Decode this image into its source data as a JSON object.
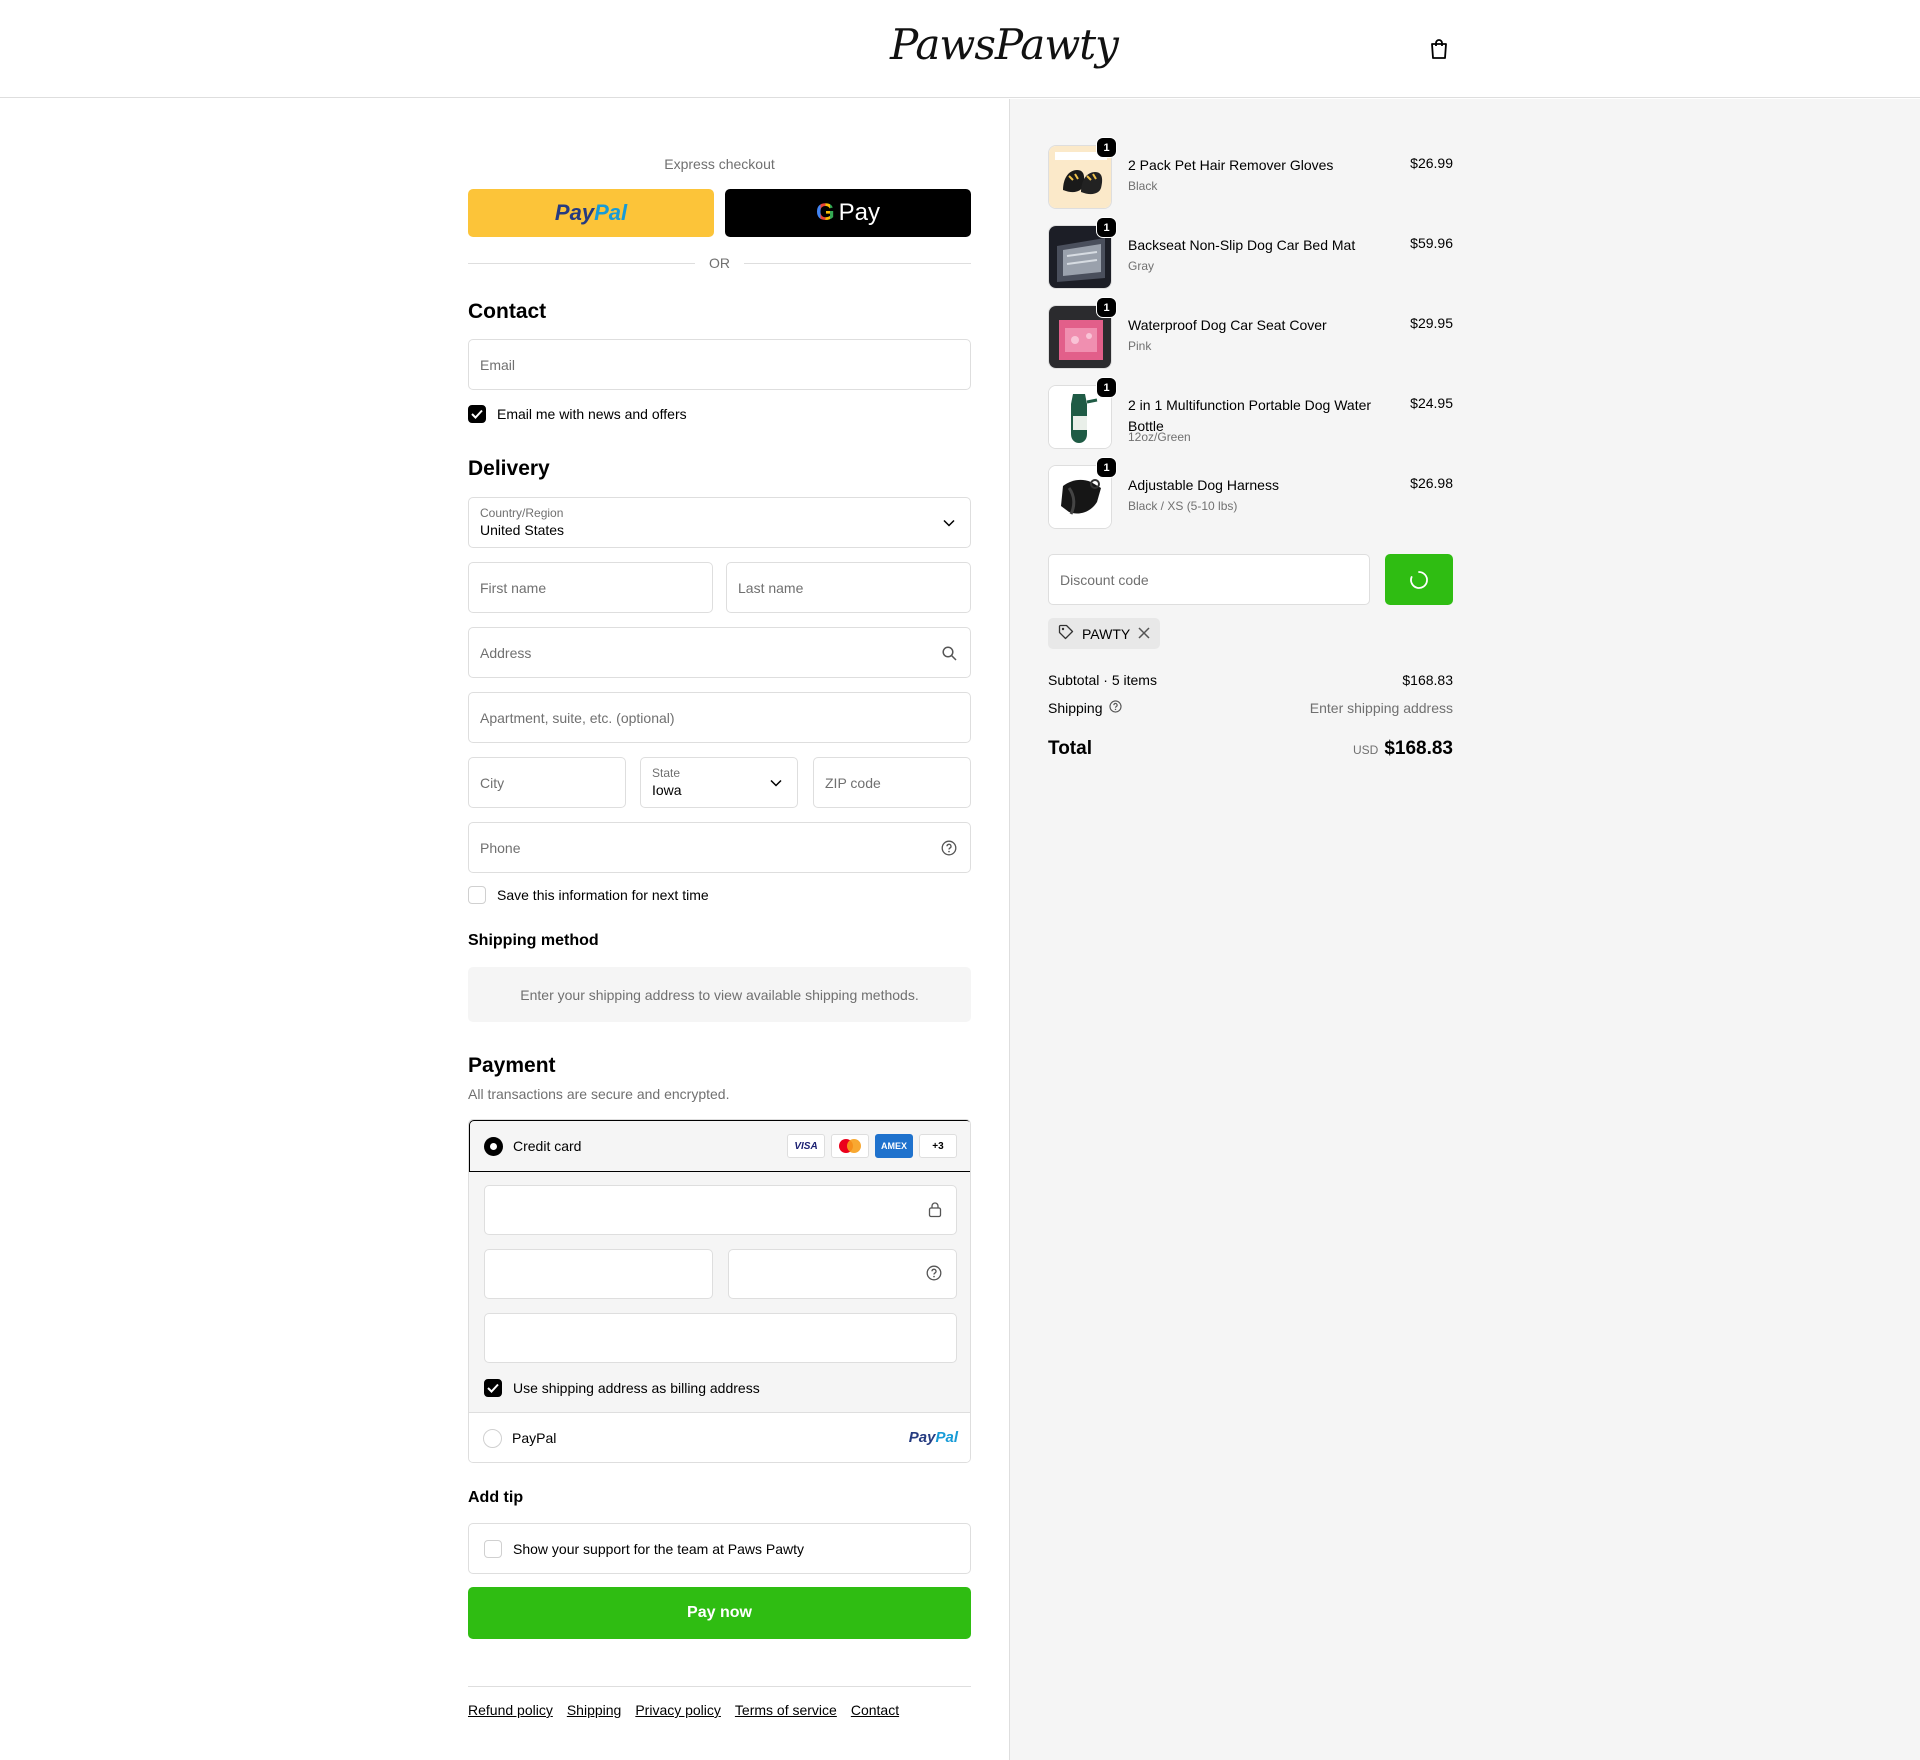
{
  "header": {
    "brand": "PawsPawty",
    "cart_icon": "shopping-bag-icon"
  },
  "express": {
    "title": "Express checkout",
    "paypal_a": "Pay",
    "paypal_b": "Pal",
    "gpay_g": "G",
    "gpay_label": "Pay",
    "or": "OR"
  },
  "contact": {
    "title": "Contact",
    "email_placeholder": "Email",
    "news_label": "Email me with news and offers",
    "news_checked": true
  },
  "delivery": {
    "title": "Delivery",
    "country_label": "Country/Region",
    "country_value": "United States",
    "first_name": "First name",
    "last_name": "Last name",
    "address": "Address",
    "apartment": "Apartment, suite, etc. (optional)",
    "city": "City",
    "state_label": "State",
    "state_value": "Iowa",
    "zip": "ZIP code",
    "phone": "Phone",
    "save_label": "Save this information for next time"
  },
  "shipping": {
    "title": "Shipping method",
    "message": "Enter your shipping address to view available shipping methods."
  },
  "payment": {
    "title": "Payment",
    "subtitle": "All transactions are secure and encrypted.",
    "credit_card_label": "Credit card",
    "cards": [
      "VISA",
      "",
      "AMEX",
      "+3"
    ],
    "billing_label": "Use shipping address as billing address",
    "paypal_label": "PayPal",
    "paypal_logo_a": "Pay",
    "paypal_logo_b": "Pal"
  },
  "tip": {
    "title": "Add tip",
    "label": "Show your support for the team at Paws Pawty"
  },
  "pay_now": "Pay now",
  "footer": [
    "Refund policy",
    "Shipping",
    "Privacy policy",
    "Terms of service",
    "Contact"
  ],
  "cart": {
    "items": [
      {
        "name": "2 Pack Pet Hair Remover Gloves",
        "variant": "Black",
        "price": "$26.99",
        "qty": "1"
      },
      {
        "name": "Backseat Non-Slip Dog Car Bed Mat",
        "variant": "Gray",
        "price": "$59.96",
        "qty": "1"
      },
      {
        "name": "Waterproof Dog Car Seat Cover",
        "variant": "Pink",
        "price": "$29.95",
        "qty": "1"
      },
      {
        "name": "2 in 1 Multifunction Portable Dog Water Bottle",
        "variant": "12oz/Green",
        "price": "$24.95",
        "qty": "1"
      },
      {
        "name": "Adjustable Dog Harness",
        "variant": "Black / XS (5-10 lbs)",
        "price": "$26.98",
        "qty": "1"
      }
    ],
    "discount_placeholder": "Discount code",
    "tag": "PAWTY",
    "subtotal_label": "Subtotal · 5 items",
    "subtotal": "$168.83",
    "shipping_label": "Shipping",
    "shipping_value": "Enter shipping address",
    "total_label": "Total",
    "currency": "USD",
    "total": "$168.83"
  },
  "colors": {
    "accent_green": "#2fbd12",
    "paypal_yellow": "#fcc439",
    "muted": "#707070"
  }
}
